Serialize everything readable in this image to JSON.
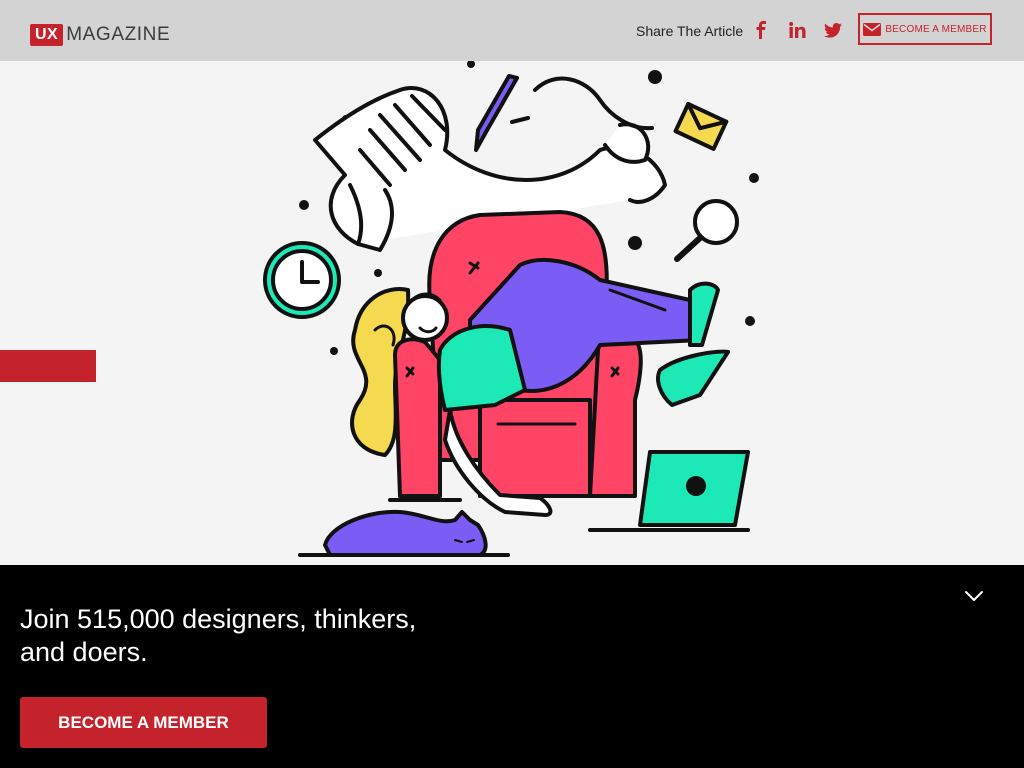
{
  "header": {
    "logo_badge": "UX",
    "logo_text": "MAGAZINE",
    "share_label": "Share The Article",
    "social": [
      {
        "name": "facebook",
        "icon": "facebook-icon"
      },
      {
        "name": "linkedin",
        "icon": "linkedin-icon"
      },
      {
        "name": "twitter",
        "icon": "twitter-icon"
      }
    ],
    "member_label": "BECOME A MEMBER"
  },
  "hero": {
    "illustration": "person-relaxing-in-armchair",
    "accent_color": "#c4232b"
  },
  "banner": {
    "headline_line1": "Join 515,000 designers, thinkers,",
    "headline_line2": "and doers.",
    "cta_label": "BECOME A MEMBER"
  },
  "colors": {
    "brand_red": "#c4232b",
    "topbar_bg": "#d3d3d3",
    "banner_bg": "#000000",
    "chair": "#ff4466",
    "shirt": "#1de9b6",
    "pants": "#7b5cf5",
    "hair": "#f5d94e"
  }
}
